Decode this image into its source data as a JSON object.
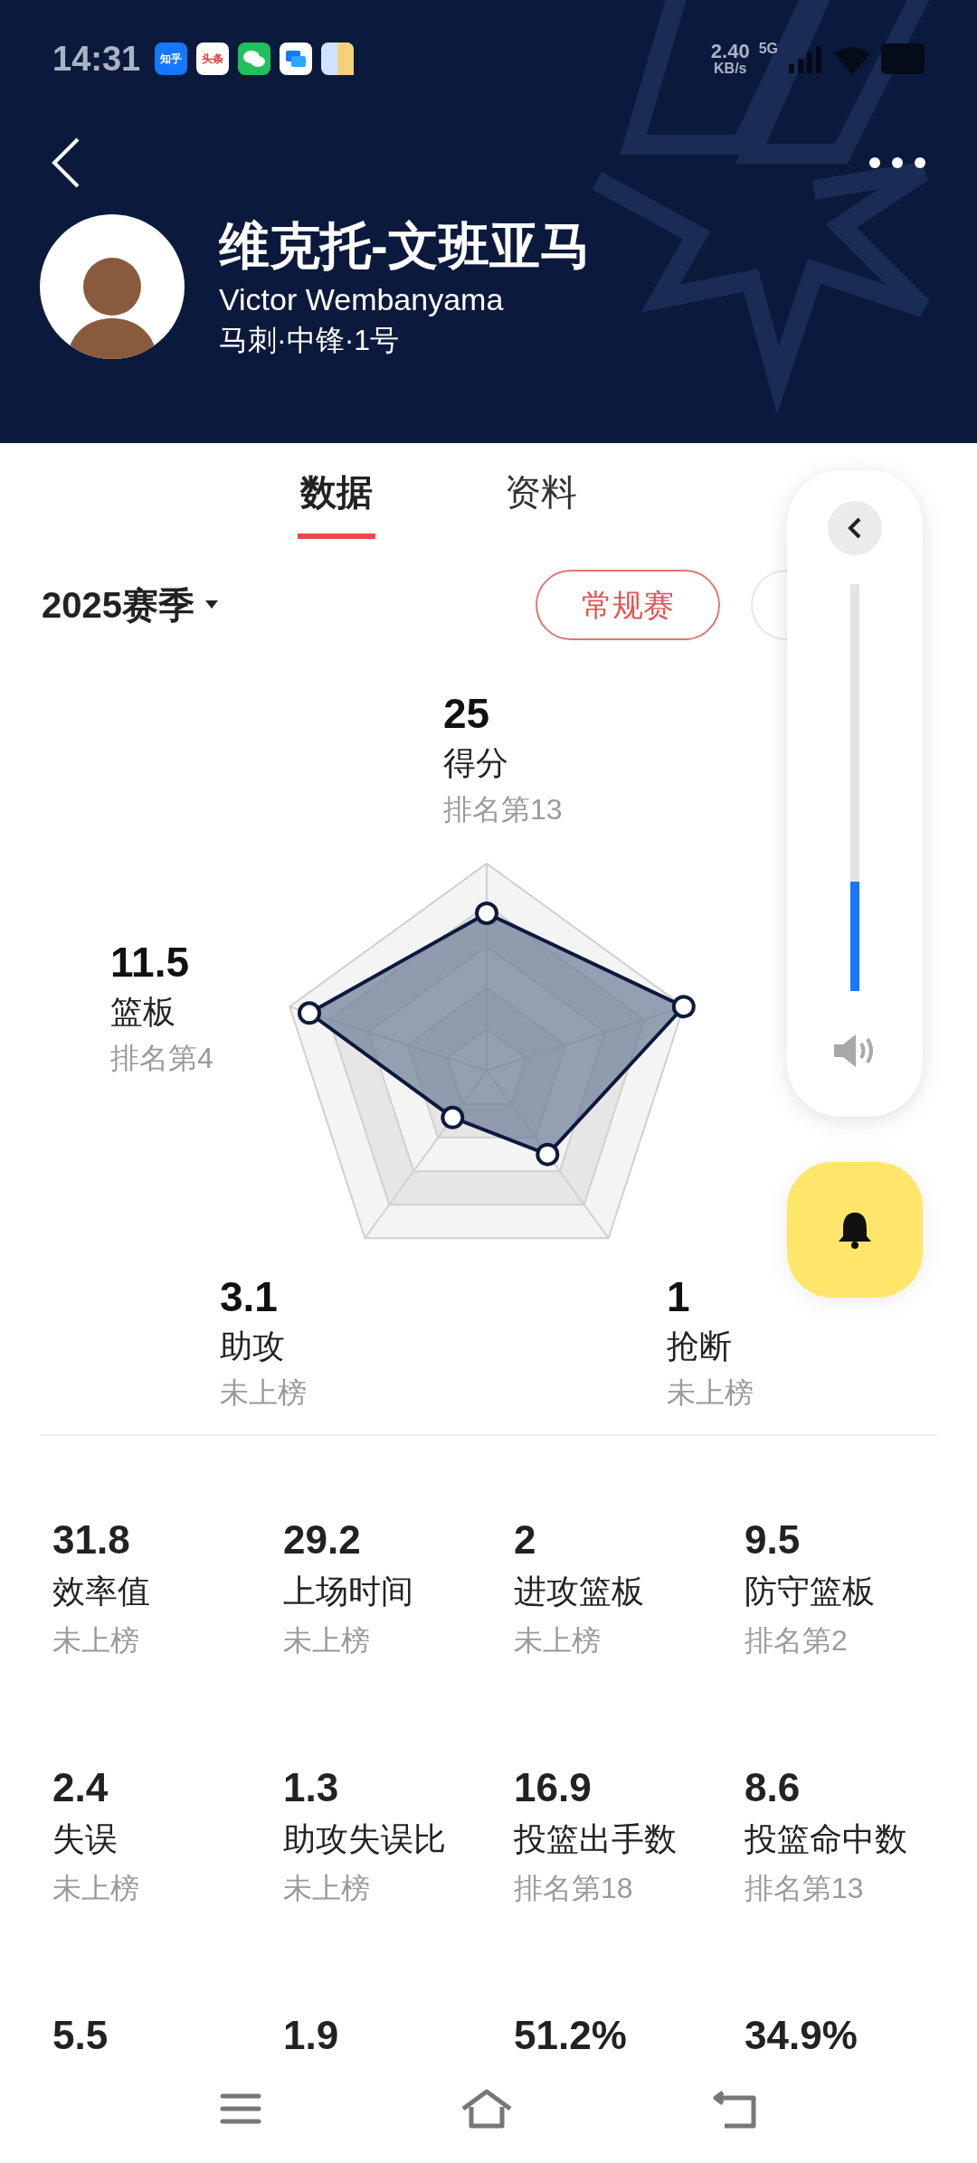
{
  "status_bar": {
    "time": "14:31",
    "app_badges": [
      {
        "label": "知乎"
      },
      {
        "label": "头条"
      }
    ],
    "net_speed": "2.40",
    "net_unit": "KB/s",
    "network": "5G"
  },
  "player": {
    "name_cn": "维克托-文班亚马",
    "name_en": "Victor Wembanyama",
    "info": "马刺·中锋·1号"
  },
  "tabs": [
    {
      "label": "数据",
      "selected": true
    },
    {
      "label": "资料",
      "selected": false
    }
  ],
  "season": {
    "label": "2025赛季"
  },
  "filters": [
    {
      "label": "常规赛",
      "selected": true
    }
  ],
  "radar": [
    {
      "value": "25",
      "label": "得分",
      "rank": "排名第13"
    },
    {
      "value": "11.5",
      "label": "篮板",
      "rank": "排名第4"
    },
    {
      "value": "3.1",
      "label": "助攻",
      "rank": "未上榜"
    },
    {
      "value": "1",
      "label": "抢断",
      "rank": "未上榜"
    }
  ],
  "volume": {
    "level": 0.27
  },
  "stats": [
    {
      "value": "31.8",
      "label": "效率值",
      "rank": "未上榜"
    },
    {
      "value": "29.2",
      "label": "上场时间",
      "rank": "未上榜"
    },
    {
      "value": "2",
      "label": "进攻篮板",
      "rank": "未上榜"
    },
    {
      "value": "9.5",
      "label": "防守篮板",
      "rank": "排名第2"
    },
    {
      "value": "2.4",
      "label": "失误",
      "rank": "未上榜"
    },
    {
      "value": "1.3",
      "label": "助攻失误比",
      "rank": "未上榜"
    },
    {
      "value": "16.9",
      "label": "投篮出手数",
      "rank": "排名第18"
    },
    {
      "value": "8.6",
      "label": "投篮命中数",
      "rank": "排名第13"
    },
    {
      "value": "5.5"
    },
    {
      "value": "1.9"
    },
    {
      "value": "51.2%"
    },
    {
      "value": "34.9%"
    }
  ]
}
